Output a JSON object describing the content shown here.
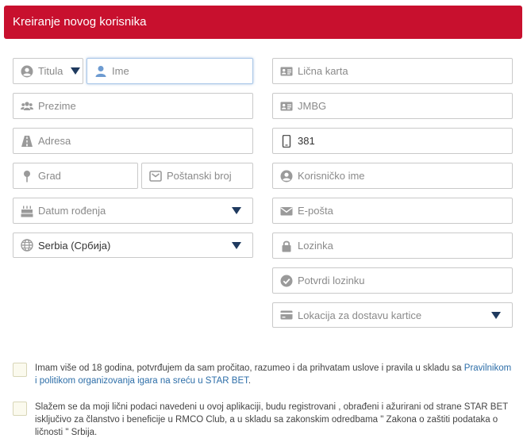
{
  "header": {
    "title": "Kreiranje novog korisnika"
  },
  "form": {
    "title_select": "Titula",
    "first_name_placeholder": "Ime",
    "last_name_placeholder": "Prezime",
    "address_placeholder": "Adresa",
    "city_placeholder": "Grad",
    "postal_placeholder": "Poštanski broj",
    "birthdate_placeholder": "Datum rođenja",
    "country_value": "Serbia (Србија)",
    "id_card_placeholder": "Lična karta",
    "jmbg_placeholder": "JMBG",
    "phone_value": "381",
    "username_placeholder": "Korisničko ime",
    "email_placeholder": "E-pošta",
    "password_placeholder": "Lozinka",
    "confirm_password_placeholder": "Potvrdi lozinku",
    "card_location_placeholder": "Lokacija za dostavu kartice"
  },
  "consents": {
    "age_text": "Imam više od 18 godina, potvrđujem da sam pročitao, razumeo i da prihvatam uslove i pravila u skladu sa",
    "age_link": "Pravilnikom i politikom organizovanja igara na sreću u STAR BET",
    "age_end": ".",
    "privacy_text": "Slažem se da moji lični podaci navedeni u ovoj aplikaciji, budu registrovani , obrađeni i ažurirani od strane STAR BET isključivo za članstvo i beneficije u RMCO Club, a u skladu sa zakonskim odredbama \" Zakona o zaštiti podataka o ličnosti \" Srbija."
  },
  "colors": {
    "brand": "#c8102e",
    "icon": "#9a9a9a",
    "arrow": "#1f3a5f",
    "link": "#2d6ea8"
  }
}
